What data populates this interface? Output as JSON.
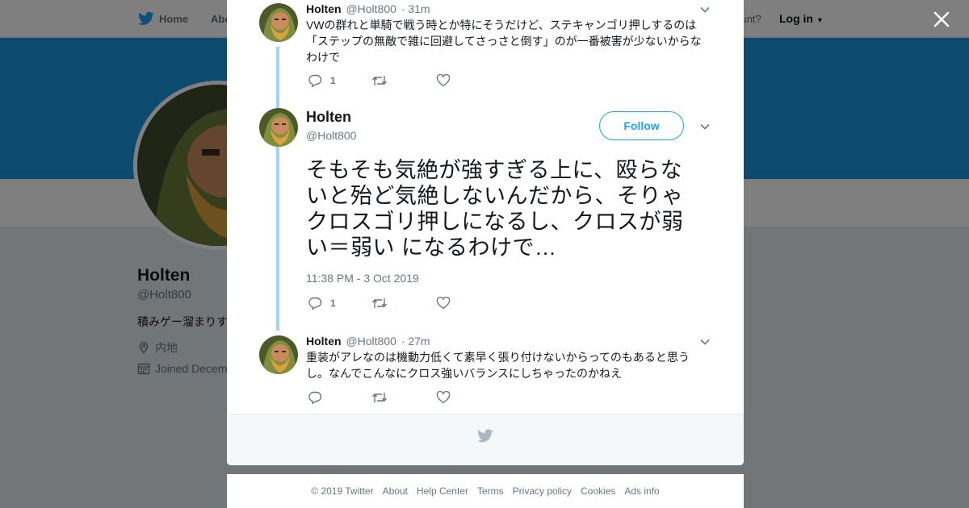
{
  "topbar": {
    "home_label": "Home",
    "about_label": "Abo",
    "have_account": "account?",
    "login_label": "Log in"
  },
  "profile": {
    "name": "Holten",
    "handle": "@Holt800",
    "bio": "積みゲー溜まりす",
    "location": "内地",
    "joined": "Joined Decem",
    "colors": {
      "banner": "#1b95e0"
    }
  },
  "modal": {
    "tweets": [
      {
        "name": "Holten",
        "handle": "@Holt800",
        "time": "· 31m",
        "text": "VWの群れと単騎で戦う時とか特にそうだけど、ステキャンゴリ押しするのは「ステップの無敵で雑に回避してさっさと倒す」のが一番被害が少ないからなわけで",
        "reply_count": "1"
      },
      {
        "name": "Holten",
        "handle": "@Holt800",
        "follow_label": "Follow",
        "text": "そもそも気絶が強すぎる上に、殴らないと殆ど気絶しないんだから、そりゃクロスゴリ押しになるし、クロスが弱い＝弱い になるわけで…",
        "timestamp": "11:38 PM - 3 Oct 2019",
        "reply_count": "1"
      },
      {
        "name": "Holten",
        "handle": "@Holt800",
        "time": "· 27m",
        "text": "重装がアレなのは機動力低くて素早く張り付けないからってのもあると思うし。なんでこんなにクロス強いバランスにしちゃったのかねえ",
        "reply_count": ""
      }
    ]
  },
  "footer": {
    "copyright": "© 2019 Twitter",
    "links": [
      "About",
      "Help Center",
      "Terms",
      "Privacy policy",
      "Cookies",
      "Ads info"
    ]
  },
  "icons": {
    "brand": "twitter-bird-icon",
    "reply": "reply-icon",
    "retweet": "retweet-icon",
    "like": "heart-icon",
    "close": "close-icon",
    "more": "chevron-down-icon"
  },
  "colors": {
    "accent": "#1da1f2",
    "thread_line": "#a5d0ee",
    "muted": "#657786"
  }
}
